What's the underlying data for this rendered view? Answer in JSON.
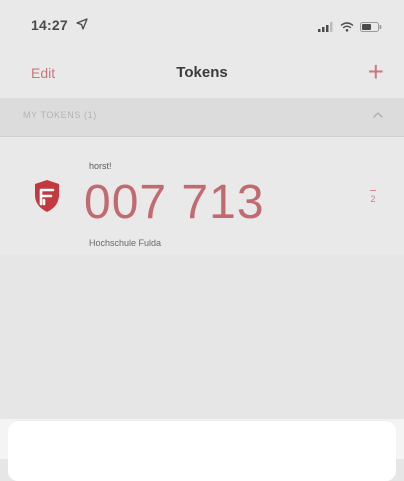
{
  "status_bar": {
    "time": "14:27",
    "location_icon": "location-arrow-icon",
    "signal_icon": "cellular-signal-icon",
    "wifi_icon": "wifi-icon",
    "battery_icon": "battery-icon"
  },
  "nav": {
    "edit_label": "Edit",
    "title": "Tokens",
    "add_label": "+"
  },
  "section": {
    "title": "MY TOKENS (1)",
    "chevron_icon": "chevron-up-icon"
  },
  "token": {
    "name": "horst!",
    "code": "007 713",
    "issuer": "Hochschule Fulda",
    "logo_icon": "shield-logo-icon",
    "timer_value": "2"
  },
  "colors": {
    "accent": "#c9787c",
    "code": "#c16b70",
    "logo": "#c23a3f"
  }
}
